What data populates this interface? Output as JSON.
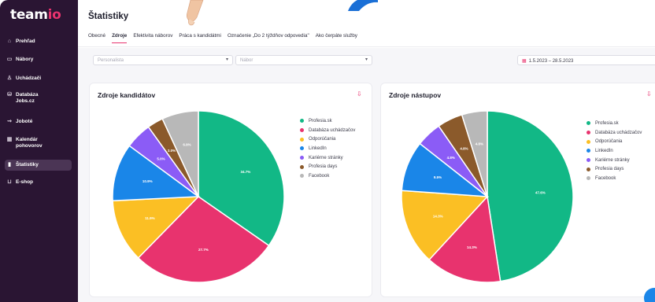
{
  "app": {
    "logo_main": "team",
    "logo_accent": "io"
  },
  "sidebar": {
    "items": [
      {
        "label": "Prehľad",
        "icon": "home-icon"
      },
      {
        "label": "Nábory",
        "icon": "briefcase-icon"
      },
      {
        "label": "Uchádzači",
        "icon": "person-icon"
      },
      {
        "label": "Databáza Jobs.cz",
        "icon": "database-icon"
      },
      {
        "label": "Joboté",
        "icon": "megaphone-icon"
      },
      {
        "label": "Kalendár pohovorov",
        "icon": "calendar-icon"
      },
      {
        "label": "Štatistiky",
        "icon": "bar-chart-icon",
        "active": true
      },
      {
        "label": "E-shop",
        "icon": "cart-icon"
      }
    ]
  },
  "header": {
    "title": "Štatistiky",
    "tabs": [
      {
        "label": "Obecné"
      },
      {
        "label": "Zdroje",
        "active": true
      },
      {
        "label": "Efektivita náborov"
      },
      {
        "label": "Práca s kandidátmi"
      },
      {
        "label": "Označenie „Do 2 týždňov odpovedia\""
      },
      {
        "label": "Ako čerpáte služby"
      }
    ]
  },
  "filters": {
    "personalista_placeholder": "Personalista",
    "nabor_placeholder": "Nábor",
    "date_range": "1.5.2023 – 28.5.2023"
  },
  "colors": {
    "accent": "#e8336e",
    "sidebar_bg": "#2a1533",
    "profesia": "#12b886",
    "databaza": "#e8336e",
    "odporucania": "#fbbf24",
    "linkedin": "#1a86e8",
    "karierne": "#8b5cf6",
    "profesia_days": "#8b5a2b",
    "facebook": "#b8b8b8"
  },
  "cards": [
    {
      "title": "Zdroje kandidátov",
      "legend": [
        "Profesia.sk",
        "Databáza uchádzačov",
        "Odporúčania",
        "LinkedIn",
        "Kariérne stránky",
        "Profesia days",
        "Facebook"
      ],
      "chart_data": {
        "type": "pie",
        "labels": [
          "Profesia.sk",
          "Databáza uchádzačov",
          "Odporúčania",
          "LinkedIn",
          "Kariérne stránky",
          "Profesia days",
          "Facebook"
        ],
        "values": [
          34.7,
          27.7,
          11.9,
          10.9,
          5.0,
          3.0,
          6.9
        ],
        "value_labels": [
          "34.7%",
          "27.7%",
          "11.9%",
          "10.9%",
          "5.0%",
          "3.0%",
          "6.9%"
        ],
        "colors": [
          "#12b886",
          "#e8336e",
          "#fbbf24",
          "#1a86e8",
          "#8b5cf6",
          "#8b5a2b",
          "#b8b8b8"
        ]
      }
    },
    {
      "title": "Zdroje nástupov",
      "legend": [
        "Profesia.sk",
        "Databáza uchádzačov",
        "Odporúčania",
        "LinkedIn",
        "Kariérne stránky",
        "Profesia days",
        "Facebook"
      ],
      "chart_data": {
        "type": "pie",
        "labels": [
          "Profesia.sk",
          "Databáza uchádzačov",
          "Odporúčania",
          "LinkedIn",
          "Kariérne stránky",
          "Profesia days",
          "Facebook"
        ],
        "values": [
          47.6,
          14.3,
          14.3,
          9.5,
          4.8,
          4.8,
          4.8
        ],
        "value_labels": [
          "47.6%",
          "14.3%",
          "14.3%",
          "9.5%",
          "4.8%",
          "4.8%",
          "4.8%"
        ],
        "colors": [
          "#12b886",
          "#e8336e",
          "#fbbf24",
          "#1a86e8",
          "#8b5cf6",
          "#8b5a2b",
          "#b8b8b8"
        ]
      }
    }
  ]
}
